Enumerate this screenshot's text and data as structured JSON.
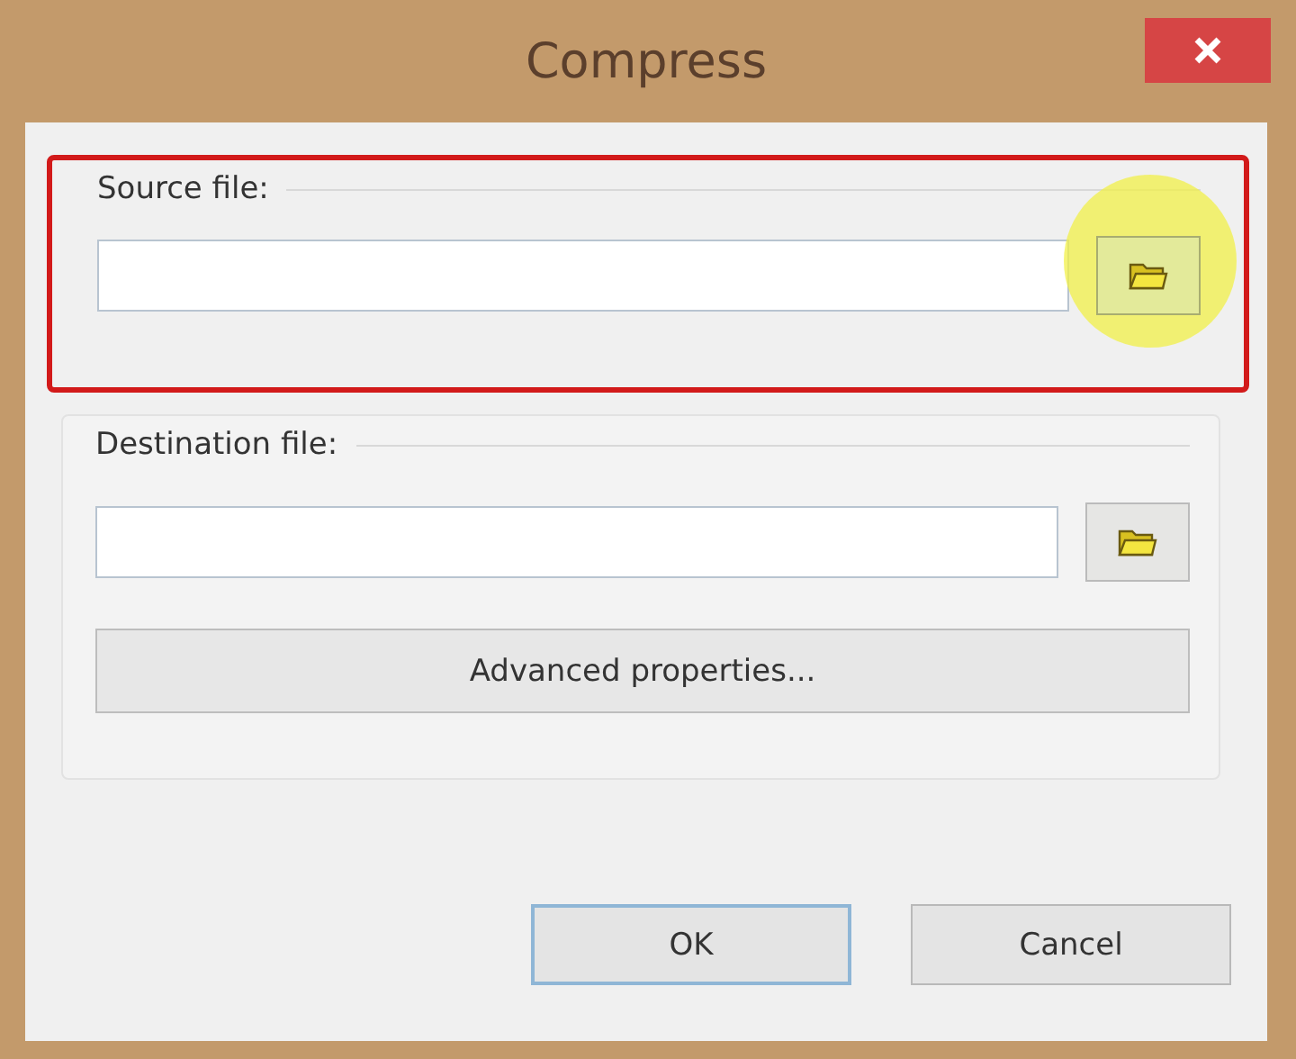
{
  "window": {
    "title": "Compress"
  },
  "groups": [
    {
      "label": "Source file:",
      "highlighted": true,
      "cursor_highlight": true
    },
    {
      "label": "Destination file:",
      "highlighted": false,
      "cursor_highlight": false
    }
  ],
  "advanced_button": "Advanced properties...",
  "buttons": [
    {
      "label": "OK",
      "default": true
    },
    {
      "label": "Cancel",
      "default": false
    }
  ]
}
